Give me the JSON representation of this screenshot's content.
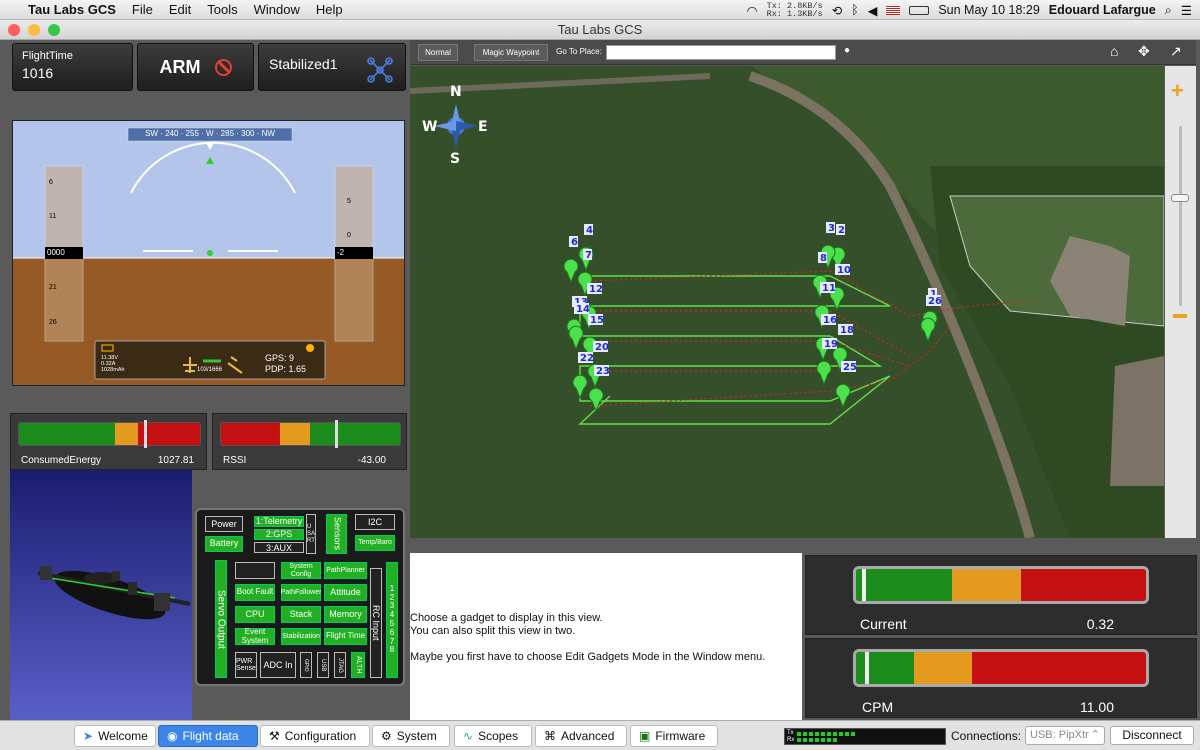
{
  "menubar": {
    "app": "Tau Labs GCS",
    "items": [
      "File",
      "Edit",
      "Tools",
      "Window",
      "Help"
    ],
    "net_tx": "Tx:  2.8KB/s",
    "net_rx": "Rx:  1.3KB/s",
    "clock": "Sun May 10  18:29",
    "user": "Edouard Lafargue"
  },
  "window": {
    "title": "Tau Labs GCS"
  },
  "top": {
    "flight_time_label": "FlightTime",
    "flight_time_value": "1016",
    "arm_label": "ARM",
    "mode_label": "Stabilized1"
  },
  "pfd": {
    "compass": "SW · 240 · 255 · W · 285 · 300 · NW",
    "speed_marks": [
      "6",
      "11",
      "0000",
      "21",
      "26"
    ],
    "alt_marks": [
      "5",
      "0",
      "-2"
    ],
    "batt_v": "11.38V",
    "batt_a": "0.32A",
    "batt_mah": "1028mAh",
    "nav": "103/1666",
    "gps": "GPS: 9",
    "pdp": "PDP: 1.65"
  },
  "gauges": {
    "energy_label": "ConsumedEnergy",
    "energy_value": "1027.81",
    "rssi_label": "RSSI",
    "rssi_value": "-43.00",
    "rssi_fraction": 0.67
  },
  "sysmap": {
    "power": "Power",
    "battery": "Battery",
    "telemetry": "1:Telemetry",
    "gps": "2:GPS",
    "aux": "3:AUX",
    "usart": "USART",
    "sensors": "Sensors",
    "i2c": "I2C",
    "tempbaro": "Temp/Baro",
    "servo": "Servo Output",
    "sysconfig": "System Config",
    "pathplanner": "PathPlanner",
    "bootfault": "Boot Fault",
    "pathfollower": "PathFollower",
    "attitude": "Attitude",
    "cpu": "CPU",
    "stack": "Stack",
    "memory": "Memory",
    "eventsystem": "Event System",
    "stabilization": "Stabilization",
    "flighttime": "Flight Time",
    "pwrsense": "PWR Sense",
    "adcin": "ADC In",
    "gpio": "GPIO",
    "usb": "USB",
    "jtag": "JTAG",
    "alth": "ALTH",
    "rcinput": "RC Input"
  },
  "mapbar": {
    "normal": "Normal",
    "magic": "Magic Waypoint",
    "goto": "Go To Place:"
  },
  "map": {
    "waypoints": [
      "1",
      "2",
      "3",
      "4",
      "6",
      "7",
      "8",
      "10",
      "11",
      "12",
      "13",
      "14",
      "15",
      "16",
      "18",
      "19",
      "20",
      "22",
      "23",
      "25",
      "26"
    ]
  },
  "center": {
    "line1": "Choose a gadget to display in this view.",
    "line2": "You can also split this view in two.",
    "line3": "Maybe you first have to choose Edit Gadgets Mode in the Window menu."
  },
  "right": {
    "current_label": "Current",
    "current_value": "0.32",
    "current_fraction": 0.02,
    "cpm_label": "CPM",
    "cpm_value": "11.00",
    "cpm_fraction": 0.03
  },
  "tabs": [
    "Welcome",
    "Flight data",
    "Configuration",
    "System",
    "Scopes",
    "Advanced",
    "Firmware"
  ],
  "status": {
    "connections_label": "Connections:",
    "device": "USB: PipXtr",
    "disconnect": "Disconnect"
  },
  "colors": {
    "accent": "#3b86e8",
    "ok": "#22b022",
    "warn": "#e8a020",
    "bad": "#cc1010"
  }
}
